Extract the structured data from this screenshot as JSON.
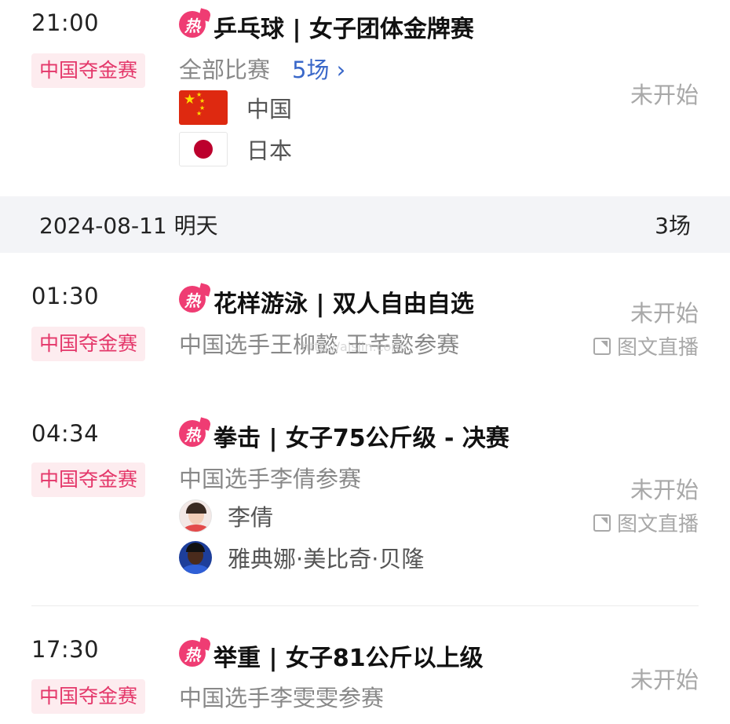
{
  "events": [
    {
      "time": "21:00",
      "badge": "中国夺金赛",
      "hot_icon_text": "热",
      "title": "乒乓球 | 女子团体金牌赛",
      "sub_text": "全部比赛",
      "more_text": "5场 ›",
      "status": "未开始",
      "teams": [
        {
          "flag": "china-flag-icon",
          "name": "中国"
        },
        {
          "flag": "japan-flag-icon",
          "name": "日本"
        }
      ]
    },
    {
      "time": "01:30",
      "badge": "中国夺金赛",
      "hot_icon_text": "热",
      "title": "花样游泳 | 双人自由自选",
      "sub_text": "中国选手王柳懿 王芊懿参赛",
      "status": "未开始",
      "live": "图文直播"
    },
    {
      "time": "04:34",
      "badge": "中国夺金赛",
      "hot_icon_text": "热",
      "title": "拳击 | 女子75公斤级 - 决赛",
      "sub_text": "中国选手李倩参赛",
      "status": "未开始",
      "live": "图文直播",
      "players": [
        {
          "avatar": "avatar",
          "name": "李倩"
        },
        {
          "avatar": "avatar",
          "name": "雅典娜·美比奇·贝隆"
        }
      ]
    },
    {
      "time": "17:30",
      "badge": "中国夺金赛",
      "hot_icon_text": "热",
      "title": "举重 | 女子81公斤以上级",
      "sub_text": "中国选手李雯雯参赛",
      "status": "未开始"
    }
  ],
  "date_header": {
    "date": "2024-08-11 明天",
    "count": "3场"
  },
  "watermark": "http://ajsjin.com/",
  "colors": {
    "badge_bg": "#fdecef",
    "badge_text": "#e4376a",
    "hot_icon": "#ef3c73",
    "link": "#3a68c9",
    "status": "#a8a8a8",
    "date_bar_bg": "#f3f4f7"
  }
}
